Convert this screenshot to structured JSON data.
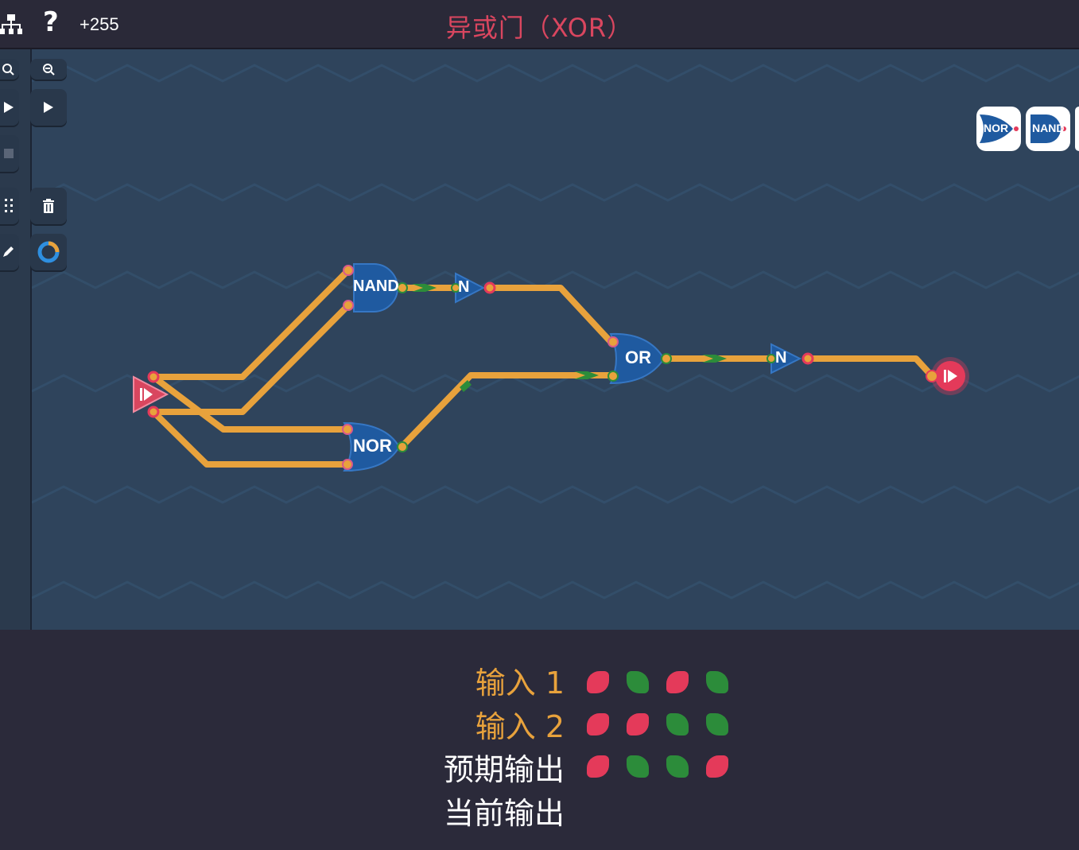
{
  "header": {
    "title": "异或门（XOR）",
    "help": "?",
    "score": "+255"
  },
  "gates": {
    "nand": "NAND",
    "nor": "NOR",
    "or": "OR",
    "not1": "N",
    "not2": "N"
  },
  "palette": {
    "item1": "NOR",
    "item2": "NAND"
  },
  "truth_table": {
    "labels": {
      "input1": "输入 1",
      "input2": "输入 2",
      "expected": "预期输出",
      "current": "当前输出"
    },
    "input1": [
      "off",
      "on",
      "off",
      "on"
    ],
    "input2": [
      "off",
      "off",
      "on",
      "on"
    ],
    "expected": [
      "off",
      "on",
      "on",
      "off"
    ],
    "current": []
  },
  "colors": {
    "wire": "#e8a23c",
    "gate": "#1f5aa0",
    "on": "#2c8c3a",
    "off": "#e43a5a",
    "title": "#d9465f",
    "label_orange": "#e8a23c"
  },
  "icons": [
    "hierarchy-icon",
    "zoom-in-icon",
    "zoom-out-icon",
    "play-icon",
    "stop-icon",
    "grid-icon",
    "trash-icon",
    "pencil-icon",
    "loop-icon"
  ]
}
